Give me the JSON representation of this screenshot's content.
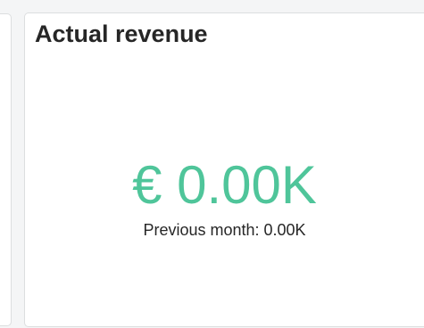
{
  "kpi_card": {
    "title": "Actual revenue",
    "currency_symbol": "€",
    "value": "0.00K",
    "previous_label": "Previous month:",
    "previous_value": "0.00K"
  },
  "colors": {
    "value_accent": "#4fc59a",
    "title_text": "#262626",
    "card_border": "#dcdedf",
    "page_background": "#f4f5f6"
  }
}
